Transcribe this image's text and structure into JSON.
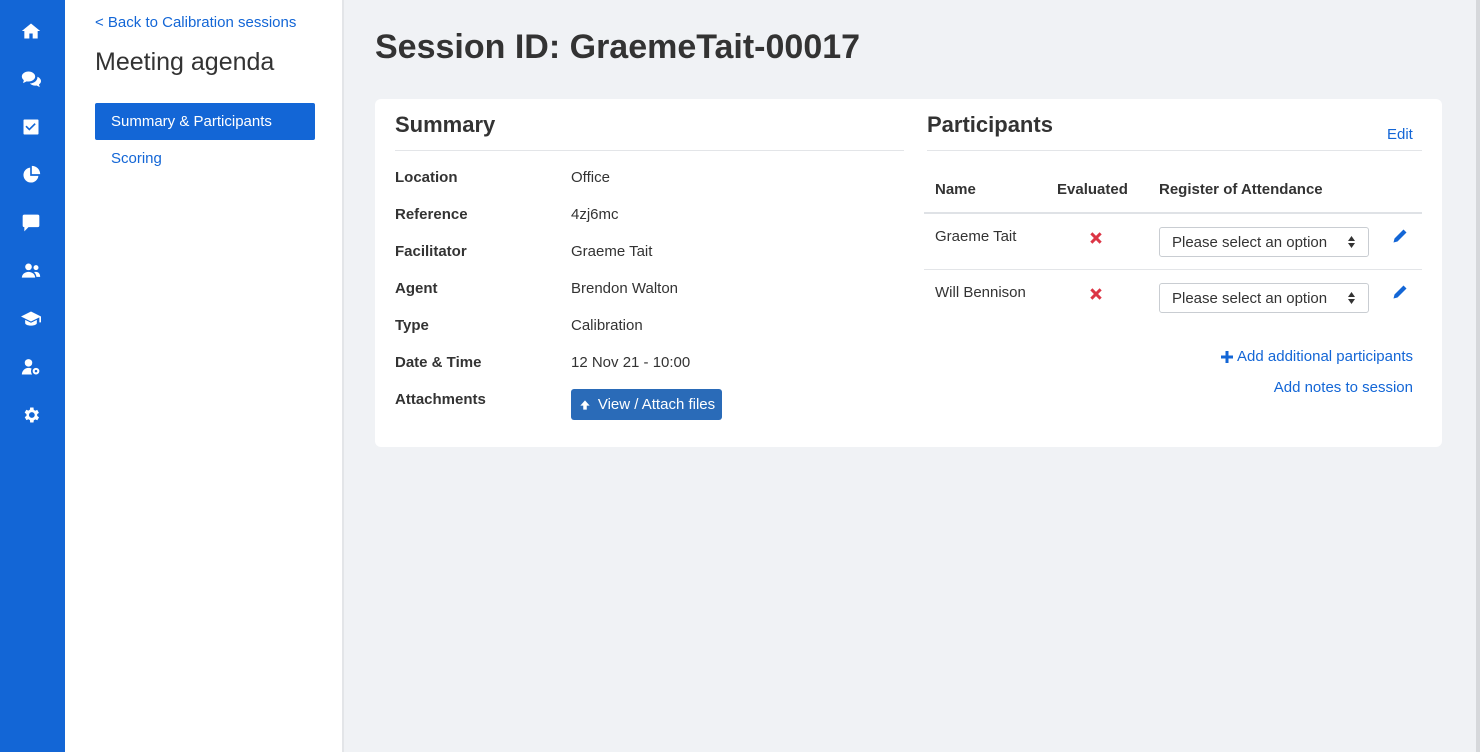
{
  "rail": {
    "icons": [
      "home-icon",
      "comments-icon",
      "check-square-icon",
      "pie-chart-icon",
      "comment-icon",
      "users-icon",
      "graduation-cap-icon",
      "user-cog-icon",
      "gear-icon"
    ]
  },
  "subnav": {
    "back_label": "< Back to Calibration sessions",
    "title": "Meeting agenda",
    "items": [
      {
        "label": "Summary & Participants",
        "active": true
      },
      {
        "label": "Scoring",
        "active": false
      }
    ]
  },
  "page": {
    "title_prefix": "Session ID:",
    "title_value": "GraemeTait-00017"
  },
  "summary": {
    "title": "Summary",
    "rows": [
      {
        "label": "Location",
        "value": "Office"
      },
      {
        "label": "Reference",
        "value": "4zj6mc"
      },
      {
        "label": "Facilitator",
        "value": "Graeme Tait"
      },
      {
        "label": "Agent",
        "value": "Brendon Walton"
      },
      {
        "label": "Type",
        "value": "Calibration"
      },
      {
        "label": "Date & Time",
        "value": "12 Nov 21 - 10:00"
      }
    ],
    "attachments_label": "Attachments",
    "attach_button": "View / Attach files"
  },
  "participants": {
    "title": "Participants",
    "edit_label": "Edit",
    "columns": [
      "Name",
      "Evaluated",
      "Register of Attendance"
    ],
    "rows": [
      {
        "name": "Graeme Tait",
        "evaluated": false,
        "attendance": "Please select an option"
      },
      {
        "name": "Will Bennison",
        "evaluated": false,
        "attendance": "Please select an option"
      }
    ],
    "add_label": "Add additional participants",
    "notes_label": "Add notes to session"
  },
  "colors": {
    "accent": "#1366d6",
    "button": "#2a6bb8",
    "not_evaluated": "#dc3545",
    "background": "#f0f2f5"
  }
}
